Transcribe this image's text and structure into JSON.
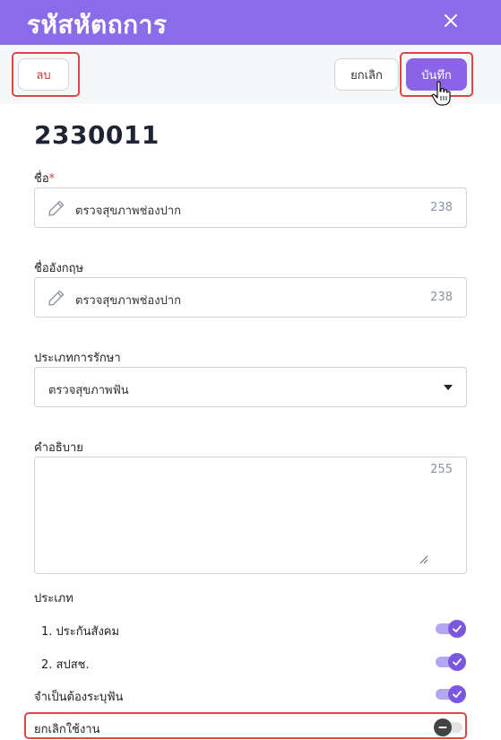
{
  "header": {
    "title": "รหัสหัตถการ"
  },
  "toolbar": {
    "delete_label": "ลบ",
    "cancel_label": "ยกเลิก",
    "save_label": "บันทึก"
  },
  "code": "2330011",
  "name_field": {
    "label": "ชื่อ",
    "required_mark": "*",
    "value": "ตรวจสุขภาพช่องปาก",
    "remaining": "238"
  },
  "name_en_field": {
    "label": "ชื่ออังกฤษ",
    "value": "ตรวจสุขภาพช่องปาก",
    "remaining": "238"
  },
  "treatment_type": {
    "label": "ประเภทการรักษา",
    "selected": "ตรวจสุขภาพฟัน"
  },
  "description": {
    "label": "คำอธิบาย",
    "value": "",
    "remaining": "255"
  },
  "types": {
    "label": "ประเภท",
    "items": [
      {
        "label": "1. ประกันสังคม",
        "on": true
      },
      {
        "label": "2. สปสช.",
        "on": true
      }
    ]
  },
  "require_tooth": {
    "label": "จำเป็นต้องระบุฟัน",
    "on": true
  },
  "disable": {
    "label": "ยกเลิกใช้งาน",
    "on": false
  },
  "colors": {
    "accent": "#8a6ce8",
    "highlight": "#d84a4a",
    "danger": "#d32f2f"
  }
}
